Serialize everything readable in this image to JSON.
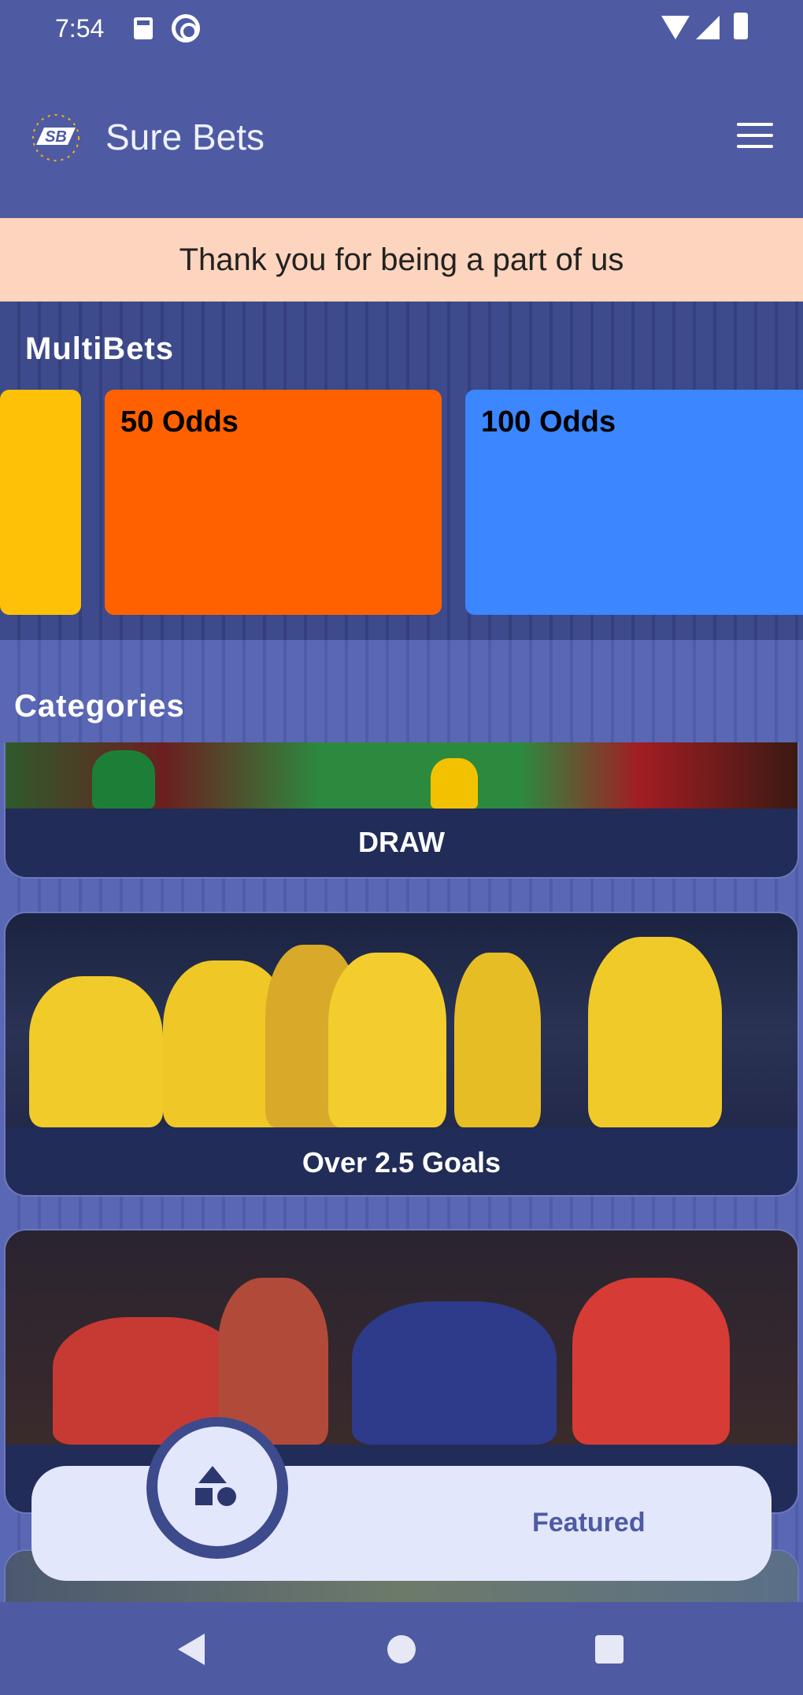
{
  "status_bar": {
    "time": "7:54",
    "icons": [
      "sd-card-icon",
      "at-icon",
      "wifi-icon",
      "signal-icon",
      "battery-icon"
    ]
  },
  "app_bar": {
    "logo_text": "SB",
    "title": "Sure Bets",
    "menu_icon": "menu-icon"
  },
  "banner": {
    "text": "Thank you for being a part of us"
  },
  "multibets": {
    "title": "MultiBets",
    "cards": [
      {
        "label": "",
        "color": "#ffc107"
      },
      {
        "label": "50 Odds",
        "color": "#ff6101"
      },
      {
        "label": "100 Odds",
        "color": "#3c86ff"
      }
    ]
  },
  "categories": {
    "title": "Categories",
    "items": [
      {
        "label": "DRAW"
      },
      {
        "label": "Over 2.5 Goals"
      },
      {
        "label": ""
      }
    ]
  },
  "bottom_nav": {
    "fab_icon": "shapes-icon",
    "featured_label": "Featured"
  },
  "system_nav": {
    "buttons": [
      "back-icon",
      "home-icon",
      "recent-apps-icon"
    ]
  },
  "colors": {
    "primary": "#4e5ba3",
    "banner_bg": "#fdd4bd",
    "card_footer": "#212c58"
  }
}
